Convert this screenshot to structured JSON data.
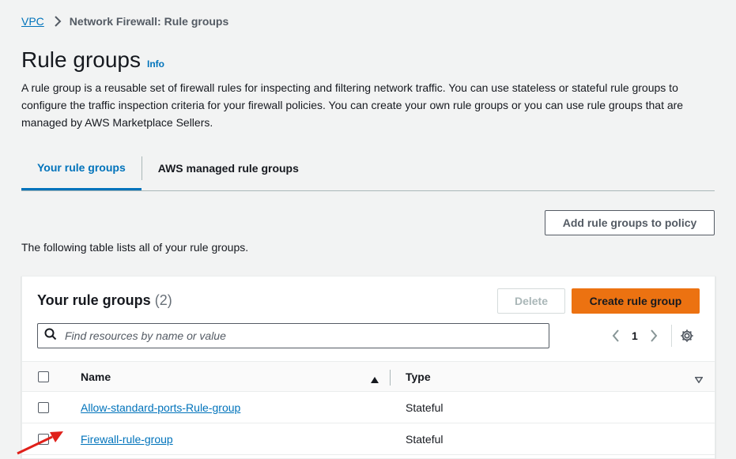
{
  "breadcrumb": {
    "root": "VPC",
    "current": "Network Firewall: Rule groups"
  },
  "page": {
    "title": "Rule groups",
    "info": "Info",
    "description": "A rule group is a reusable set of firewall rules for inspecting and filtering network traffic. You can use stateless or stateful rule groups to configure the traffic inspection criteria for your firewall policies. You can create your own rule groups or you can use rule groups that are managed by AWS Marketplace Sellers."
  },
  "tabs": [
    {
      "label": "Your rule groups",
      "active": true
    },
    {
      "label": "AWS managed rule groups",
      "active": false
    }
  ],
  "actions": {
    "add_to_policy": "Add rule groups to policy"
  },
  "table_intro": "The following table lists all of your rule groups.",
  "panel": {
    "title": "Your rule groups",
    "count": "(2)",
    "delete_label": "Delete",
    "create_label": "Create rule group",
    "search_placeholder": "Find resources by name or value",
    "page_number": "1",
    "columns": [
      "Name",
      "Type"
    ],
    "rows": [
      {
        "name": "Allow-standard-ports-Rule-group",
        "type": "Stateful"
      },
      {
        "name": "Firewall-rule-group",
        "type": "Stateful"
      }
    ]
  },
  "colors": {
    "link": "#0073bb",
    "primary": "#ec7211",
    "annotation": "#e0201a"
  },
  "icons": [
    "chevron-right-icon",
    "search-icon",
    "chevron-left-icon",
    "gear-icon",
    "sort-ascending-icon",
    "sort-descending-icon",
    "annotation-arrow"
  ]
}
